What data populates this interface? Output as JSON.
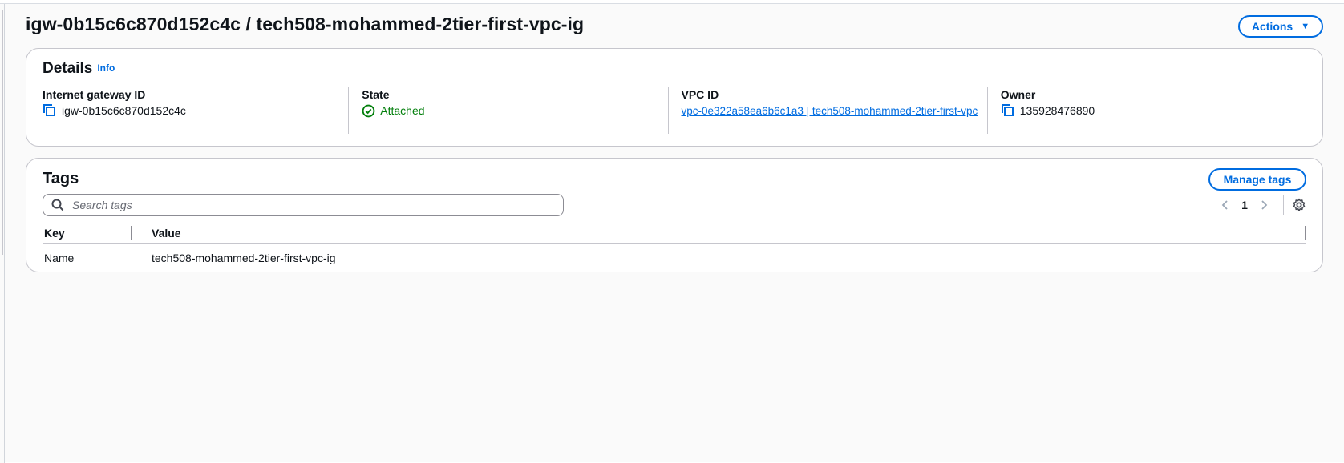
{
  "header": {
    "title": "igw-0b15c6c870d152c4c / tech508-mohammed-2tier-first-vpc-ig",
    "actions_label": "Actions",
    "actions_caret": "▼"
  },
  "details": {
    "title": "Details",
    "info_label": "Info",
    "internet_gateway_id": {
      "label": "Internet gateway ID",
      "value": "igw-0b15c6c870d152c4c"
    },
    "state": {
      "label": "State",
      "value": "Attached"
    },
    "vpc_id": {
      "label": "VPC ID",
      "value": "vpc-0e322a58ea6b6c1a3 | tech508-mohammed-2tier-first-vpc"
    },
    "owner": {
      "label": "Owner",
      "value": "135928476890"
    }
  },
  "tags": {
    "title": "Tags",
    "manage_label": "Manage tags",
    "search_placeholder": "Search tags",
    "page_number": "1",
    "columns": {
      "key": "Key",
      "value": "Value"
    },
    "rows": [
      {
        "key": "Name",
        "value": "tech508-mohammed-2tier-first-vpc-ig"
      }
    ]
  },
  "colors": {
    "accent": "#006ce0",
    "success": "#037f0c",
    "border": "#c6c6cd"
  },
  "icons": [
    "copy-icon",
    "check-circle-icon",
    "search-icon",
    "chevron-left-icon",
    "chevron-right-icon",
    "gear-icon",
    "caret-down-icon"
  ]
}
